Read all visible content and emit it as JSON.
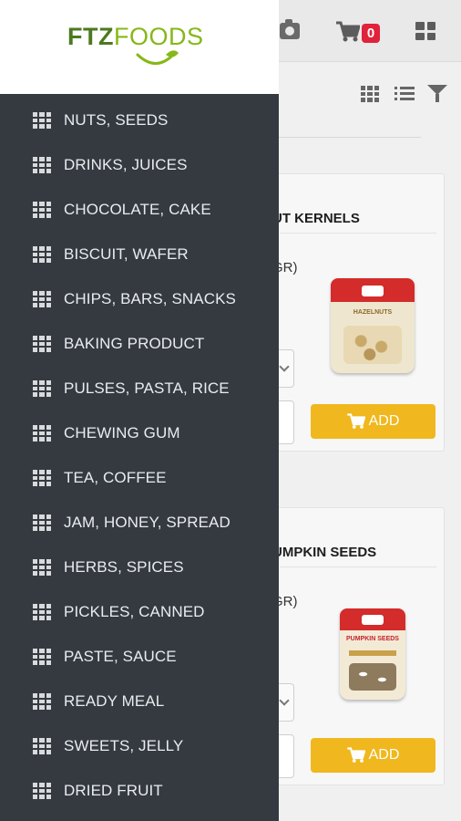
{
  "header": {
    "cart_count": "0"
  },
  "brand": {
    "logo_part1": "FTZ",
    "logo_part2": "FOODS"
  },
  "menu": {
    "items": [
      {
        "label": "NUTS, SEEDS"
      },
      {
        "label": "DRINKS, JUICES"
      },
      {
        "label": "CHOCOLATE, CAKE"
      },
      {
        "label": "BISCUIT, WAFER"
      },
      {
        "label": "CHIPS, BARS, SNACKS"
      },
      {
        "label": "BAKING PRODUCT"
      },
      {
        "label": "PULSES, PASTA, RICE"
      },
      {
        "label": "CHEWING GUM"
      },
      {
        "label": "TEA, COFFEE"
      },
      {
        "label": "JAM, HONEY, SPREAD"
      },
      {
        "label": "HERBS, SPICES"
      },
      {
        "label": "PICKLES, CANNED"
      },
      {
        "label": "PASTE, SAUCE"
      },
      {
        "label": "READY MEAL"
      },
      {
        "label": "SWEETS, JELLY"
      },
      {
        "label": "DRIED FRUIT"
      }
    ]
  },
  "products": [
    {
      "title_fragment": "UT KERNELS",
      "unit_fragment": "GR)",
      "add_label": "ADD",
      "pack_label": "HAZELNUTS"
    },
    {
      "title_fragment": "UMPKIN SEEDS",
      "unit_fragment": "GR)",
      "add_label": "ADD",
      "pack_label": "PUMPKIN SEEDS"
    }
  ],
  "colors": {
    "drawer_bg": "#343a40",
    "accent_button": "#f0b81e",
    "badge": "#e0223a",
    "logo_dark": "#4b7a1e",
    "logo_light": "#86b817"
  },
  "icons": [
    "camera-icon",
    "cart-icon",
    "grid-view-icon",
    "list-view-icon",
    "filter-icon",
    "category-grid-icon"
  ]
}
